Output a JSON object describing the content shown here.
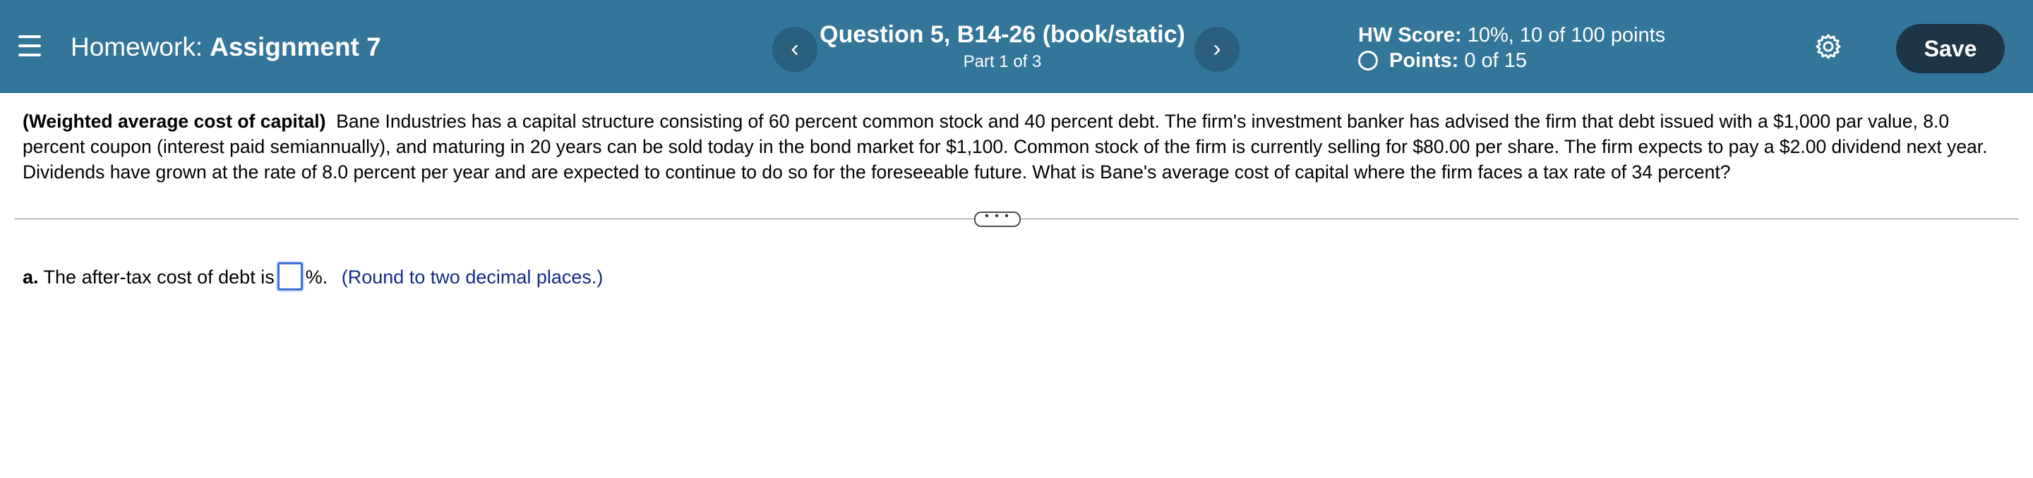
{
  "header": {
    "menu_icon": "hamburger-menu-icon",
    "hw_prefix": "Homework:",
    "hw_name": "Assignment 7",
    "prev_glyph": "‹",
    "next_glyph": "›",
    "question_title": "Question 5, B14-26 (book/static)",
    "question_part": "Part 1 of 3",
    "score_label": "HW Score:",
    "score_value": "10%, 10 of 100 points",
    "points_label": "Points:",
    "points_value": "0 of 15",
    "settings_icon": "gear-icon",
    "save_label": "Save"
  },
  "problem": {
    "topic": "(Weighted average cost of capital)",
    "text": "Bane Industries has a capital structure consisting of 60 percent common stock and 40 percent debt.  The firm's investment banker has advised the firm that debt issued with a $1,000 par value, 8.0 percent coupon (interest paid semiannually), and maturing in 20 years can be sold today in the bond market for $1,100.  Common stock of the firm is currently selling for $80.00 per share.  The firm expects to pay a $2.00 dividend next year.  Dividends have grown at the rate of 8.0 percent per year and are expected to continue to do so for the foreseeable future.  What is  Bane's average cost of capital where the firm faces a tax rate of 34 percent?"
  },
  "more_label": "• • •",
  "answer": {
    "part_label": "a.",
    "prefix": "The after-tax cost of debt is",
    "value": "",
    "suffix": "%.",
    "hint": "(Round to two decimal places.)"
  }
}
